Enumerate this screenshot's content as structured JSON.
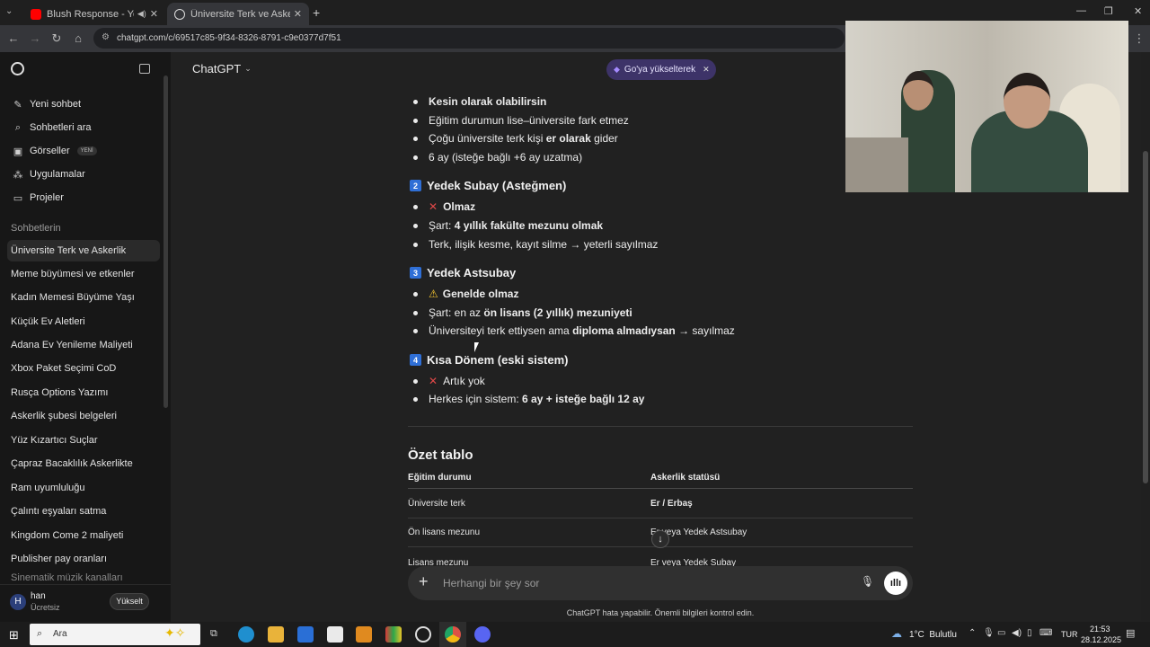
{
  "browser": {
    "tabs": [
      {
        "title": "Blush Response - YouTube",
        "active": false
      },
      {
        "title": "Üniversite Terk ve Askerlik",
        "active": true
      }
    ],
    "url": "chatgpt.com/c/69517c85-9f34-8326-8791-c9e0377d7f51"
  },
  "sidebar": {
    "actions": [
      {
        "label": "Yeni sohbet",
        "icon": "pencil-icon"
      },
      {
        "label": "Sohbetleri ara",
        "icon": "search-icon"
      },
      {
        "label": "Görseller",
        "icon": "image-icon",
        "badge": "YENİ"
      },
      {
        "label": "Uygulamalar",
        "icon": "apps-icon"
      },
      {
        "label": "Projeler",
        "icon": "folder-icon"
      }
    ],
    "section_title": "Sohbetlerin",
    "chats": [
      "Üniversite Terk ve Askerlik",
      "Meme büyümesi ve etkenler",
      "Kadın Memesi Büyüme Yaşı",
      "Küçük Ev Aletleri",
      "Adana Ev Yenileme Maliyeti",
      "Xbox Paket Seçimi CoD",
      "Rusça Options Yazımı",
      "Askerlik şubesi belgeleri",
      "Yüz Kızartıcı Suçlar",
      "Çapraz Bacaklılık Askerlikte",
      "Ram uyumluluğu",
      "Çalıntı eşyaları satma",
      "Kingdom Come 2 maliyeti",
      "Publisher pay oranları",
      "Sinematik müzik kanalları"
    ],
    "user": {
      "initial": "H",
      "name": "han",
      "plan": "Ücretsiz",
      "upgrade_label": "Yükselt"
    }
  },
  "header": {
    "model": "ChatGPT",
    "upgrade_pill": "Go'ya yükselterek"
  },
  "content": {
    "sec1_bullets": [
      {
        "html": "<b>Kesin olarak olabilirsin</b>"
      },
      {
        "html": "Eğitim durumun lise–üniversite fark etmez"
      },
      {
        "html": "Çoğu üniversite terk kişi <b>er olarak</b> gider"
      },
      {
        "html": "6 ay (isteğe bağlı +6 ay uzatma)"
      }
    ],
    "sec2_title": "Yedek Subay (Asteğmen)",
    "sec2_num": "2",
    "sec2_bullets": [
      {
        "html": "<span class='xmark'>✕</span><b>Olmaz</b>"
      },
      {
        "html": "Şart: <b>4 yıllık fakülte mezunu olmak</b>"
      },
      {
        "html": "Terk, ilişik kesme, kayıt silme → yeterli sayılmaz"
      }
    ],
    "sec3_title": "Yedek Astsubay",
    "sec3_num": "3",
    "sec3_bullets": [
      {
        "html": "<span class='warn'>⚠</span><b>Genelde olmaz</b>"
      },
      {
        "html": "Şart: en az <b>ön lisans (2 yıllık) mezuniyeti</b>"
      },
      {
        "html": "Üniversiteyi terk ettiysen ama <b>diploma almadıysan</b> → sayılmaz"
      }
    ],
    "sec4_title": "Kısa Dönem (eski sistem)",
    "sec4_num": "4",
    "sec4_bullets": [
      {
        "html": "<span class='xmark'>✕</span>Artık yok"
      },
      {
        "html": "Herkes için sistem: <b>6 ay + isteğe bağlı 12 ay</b>"
      }
    ],
    "summary_title": "Özet tablo",
    "table": {
      "headers": [
        "Eğitim durumu",
        "Askerlik statüsü"
      ],
      "rows": [
        [
          "Üniversite terk",
          "Er / Erbaş"
        ],
        [
          "Ön lisans mezunu",
          "Er veya Yedek Astsubay"
        ],
        [
          "Lisans mezunu",
          "Er veya Yedek Subay"
        ]
      ]
    }
  },
  "composer": {
    "placeholder": "Herhangi bir şey sor",
    "disclaimer": "ChatGPT hata yapabilir. Önemli bilgileri kontrol edin."
  },
  "taskbar": {
    "search_label": "Ara",
    "weather": "1°C  Bulutlu",
    "lang": "TUR",
    "time": "21:53",
    "date": "28.12.2025"
  },
  "colors": {
    "accent_purple": "#7b5ce1",
    "badge_blue": "#2f6fd6",
    "x_red": "#e04848"
  }
}
